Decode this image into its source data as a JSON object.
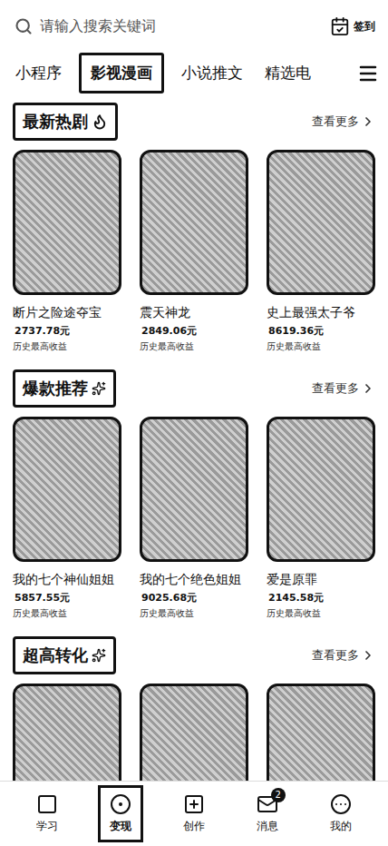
{
  "search": {
    "placeholder": "请输入搜索关键词"
  },
  "checkin": {
    "label": "签到"
  },
  "tabs": [
    {
      "label": "小程序",
      "selected": false
    },
    {
      "label": "影视漫画",
      "selected": true
    },
    {
      "label": "小说推文",
      "selected": false
    },
    {
      "label": "精选电",
      "selected": false
    }
  ],
  "sections": [
    {
      "title": "最新热剧",
      "kind": "flame",
      "more": "查看更多",
      "cards": [
        {
          "title": "断片之险途夺宝",
          "amount": "2737.78元",
          "caption": "历史最高收益"
        },
        {
          "title": "震天神龙",
          "amount": "2849.06元",
          "caption": "历史最高收益"
        },
        {
          "title": "史上最强太子爷",
          "amount": "8619.36元",
          "caption": "历史最高收益"
        }
      ]
    },
    {
      "title": "爆款推荐",
      "kind": "sparkle",
      "more": "查看更多",
      "cards": [
        {
          "title": "我的七个神仙姐姐",
          "amount": "5857.55元",
          "caption": "历史最高收益"
        },
        {
          "title": "我的七个绝色姐姐",
          "amount": "9025.68元",
          "caption": "历史最高收益"
        },
        {
          "title": "爱是原罪",
          "amount": "2145.58元",
          "caption": "历史最高收益"
        }
      ]
    },
    {
      "title": "超高转化",
      "kind": "sparkle",
      "more": "查看更多",
      "cards": [
        {},
        {},
        {}
      ]
    }
  ],
  "nav": [
    {
      "label": "学习",
      "selected": false
    },
    {
      "label": "变现",
      "selected": true
    },
    {
      "label": "创作",
      "selected": false
    },
    {
      "label": "消息",
      "selected": false,
      "badge": "2"
    },
    {
      "label": "我的",
      "selected": false
    }
  ]
}
